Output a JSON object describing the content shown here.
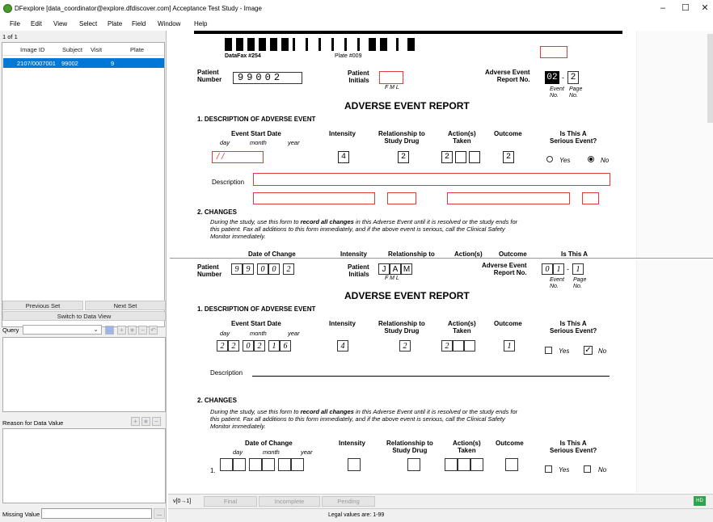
{
  "window": {
    "title": "DFexplore [data_coordinator@explore.dfdiscover.com] Acceptance Test Study - Image",
    "minimize": "–",
    "maximize": "☐",
    "close": "✕"
  },
  "menu": [
    "File",
    "Edit",
    "View",
    "Select",
    "Plate",
    "Field",
    "Window",
    "Help"
  ],
  "left": {
    "count": "1 of 1",
    "columns": [
      "Image ID",
      "Subject",
      "Visit",
      "Plate"
    ],
    "row": {
      "image_id": "2107/0007001",
      "subject": "99002",
      "visit": "9",
      "plate": ""
    },
    "previous_set": "Previous Set",
    "next_set": "Next Set",
    "switch_view": "Switch to Data View",
    "query_label": "Query",
    "reason_label": "Reason for Data Value",
    "missing_label": "Missing Value",
    "ellipsis": "..."
  },
  "top_form": {
    "datafax": "DataFax #254",
    "plate": "Plate #009",
    "patient_number_label": [
      "Patient",
      "Number"
    ],
    "patient_digits": [
      "9",
      "9",
      "0",
      "0",
      "2"
    ],
    "patient_initials_label": [
      "Patient",
      "Initials"
    ],
    "initials_sub": "F    M    L",
    "ae_report_label": [
      "Adverse Event",
      "Report No."
    ],
    "event_no_value": "02",
    "dash": "-",
    "page_no_value": "2",
    "event_no": [
      "Event",
      "No."
    ],
    "page_no": [
      "Page",
      "No."
    ],
    "title": "ADVERSE EVENT REPORT",
    "section1": "1. DESCRIPTION OF ADVERSE EVENT",
    "start_date": "Event Start Date",
    "date_sub": [
      "day",
      "month",
      "year"
    ],
    "intensity": "Intensity",
    "relationship": [
      "Relationship to",
      "Study Drug"
    ],
    "actions": [
      "Action(s)",
      "Taken"
    ],
    "outcome": "Outcome",
    "serious": [
      "Is This A",
      "Serious Event?"
    ],
    "date_value": "/ /",
    "intensity_value": "4",
    "relationship_value": "2",
    "action_value": "2",
    "outcome_value": "2",
    "yes": "Yes",
    "no": "No",
    "description": "Description",
    "section2": "2. CHANGES",
    "changes_text_1a": "During the study, use this form to ",
    "changes_text_1b": "record all changes",
    "changes_text_1c": " in this Adverse Event until it is resolved or the study ends for",
    "changes_text_2": "this patient. Fax all additions to this form immediately, and if the above event is serious, call the Clinical Safety",
    "changes_text_3": "Monitor immediately.",
    "date_of_change": "Date of Change",
    "intensity2": "Intensity",
    "relationship2": "Relationship to",
    "actions2": "Action(s)",
    "outcome2": "Outcome",
    "serious2": "Is This A"
  },
  "bottom_form": {
    "patient_number_label": [
      "Patient",
      "Number"
    ],
    "patient_digits": [
      "9",
      "9",
      "0",
      "0",
      "2"
    ],
    "patient_initials_label": [
      "Patient",
      "Initials"
    ],
    "initials": [
      "J",
      "A",
      "M"
    ],
    "initials_sub": "F    M    L",
    "ae_report_label": [
      "Adverse Event",
      "Report No."
    ],
    "event_digits": [
      "0",
      "1"
    ],
    "page_digit": "1",
    "dash": "-",
    "event_no": [
      "Event",
      "No."
    ],
    "page_no": [
      "Page",
      "No."
    ],
    "title": "ADVERSE EVENT REPORT",
    "section1": "1. DESCRIPTION OF ADVERSE EVENT",
    "start_date": "Event Start Date",
    "date_sub": [
      "day",
      "month",
      "year"
    ],
    "intensity": "Intensity",
    "relationship": [
      "Relationship to",
      "Study Drug"
    ],
    "actions": [
      "Action(s)",
      "Taken"
    ],
    "outcome": "Outcome",
    "serious": [
      "Is This A",
      "Serious Event?"
    ],
    "date_digits": [
      "2",
      "2",
      "0",
      "2",
      "1",
      "6"
    ],
    "intensity_value": "4",
    "relationship_value": "2",
    "action_value": "2",
    "outcome_value": "1",
    "yes": "Yes",
    "no": "No",
    "check": "✓",
    "description": "Description",
    "section2": "2. CHANGES",
    "changes_text_1a": "During the study, use this form to ",
    "changes_text_1b": "record all changes",
    "changes_text_1c": " in this Adverse Event until it is resolved or the study ends for",
    "changes_text_2": "this patient. Fax all additions to this form immediately, and if the above event is serious, call the Clinical Safety",
    "changes_text_3": "Monitor immediately.",
    "date_of_change": "Date of Change",
    "intensity2": "Intensity",
    "relationship2": [
      "Relationship to",
      "Study Drug"
    ],
    "actions2": [
      "Action(s)",
      "Taken"
    ],
    "outcome2": "Outcome",
    "serious2": [
      "Is This A",
      "Serious Event?"
    ],
    "row1": "1."
  },
  "status": {
    "version": "v[0→1]",
    "final": "Final",
    "incomplete": "Incomplete",
    "pending": "Pending",
    "legal": "Legal values are: 1-99",
    "hd": "HD"
  }
}
